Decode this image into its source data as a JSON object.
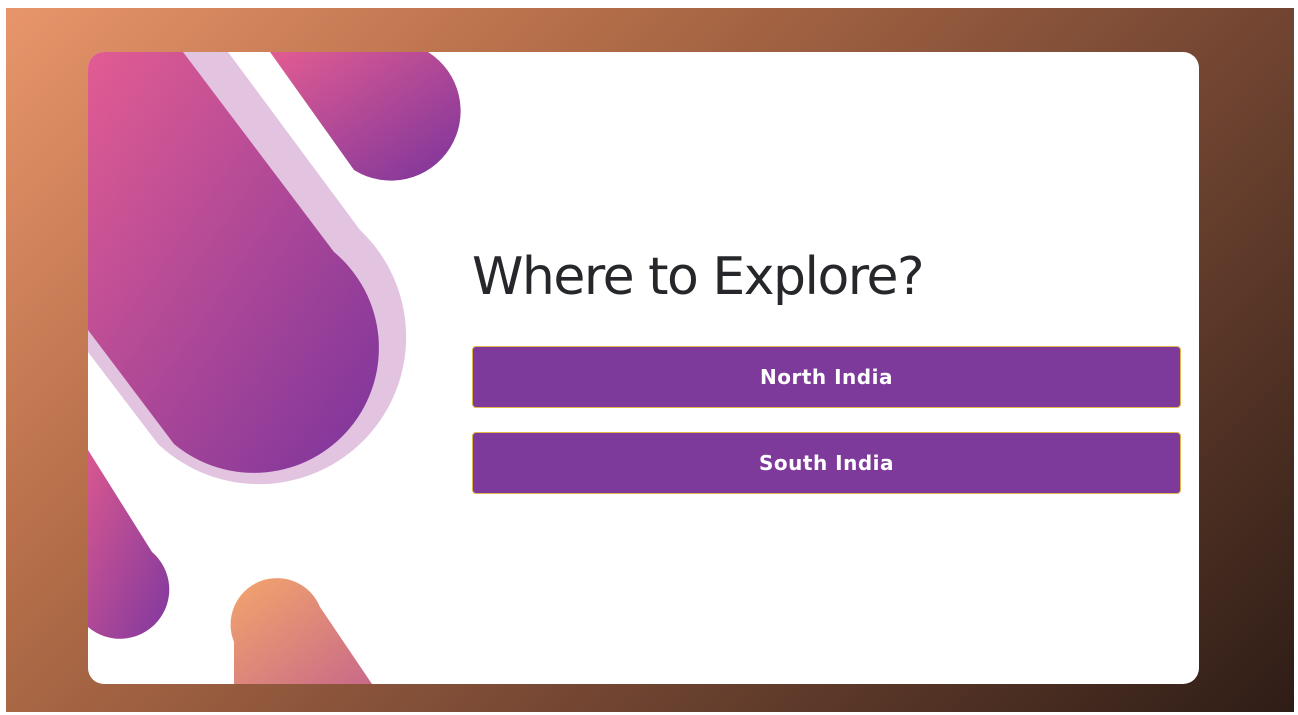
{
  "page": {
    "title": "Where to Explore?"
  },
  "options": [
    {
      "label": "North India"
    },
    {
      "label": "South India"
    }
  ],
  "colors": {
    "button": "#7e3a9b",
    "button_border": "#e0b64a",
    "title": "#25272b"
  }
}
